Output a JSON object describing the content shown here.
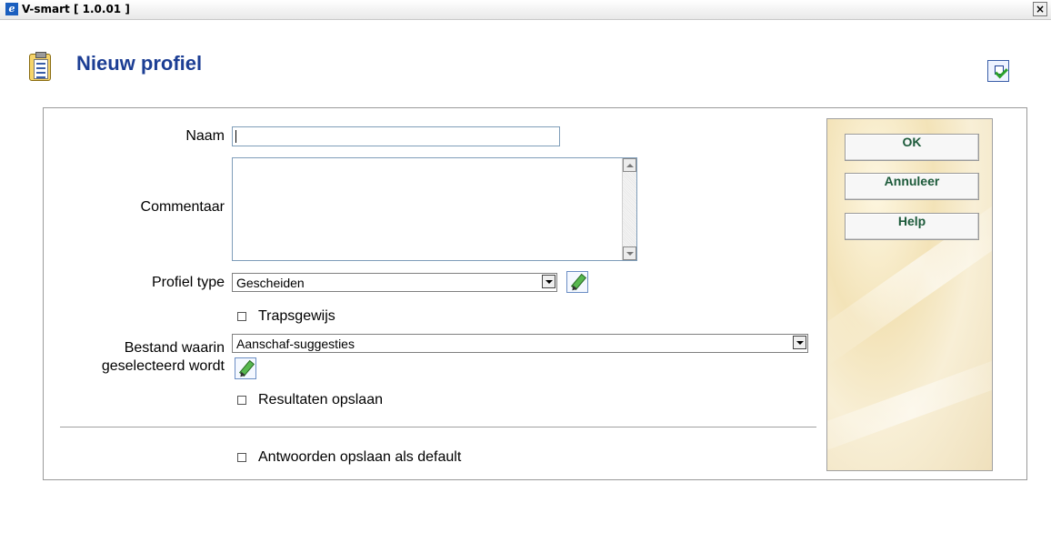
{
  "window": {
    "title": "V-smart [ 1.0.01 ]",
    "close_glyph": "×"
  },
  "header": {
    "title": "Nieuw profiel"
  },
  "form": {
    "naam_label": "Naam",
    "naam_value": "",
    "commentaar_label": "Commentaar",
    "commentaar_value": "",
    "profiel_type_label": "Profiel type",
    "profiel_type_value": "Gescheiden",
    "trapsgewijs_label": "Trapsgewijs",
    "trapsgewijs_checked": false,
    "bestand_label_line1": "Bestand waarin",
    "bestand_label_line2": "geselecteerd wordt",
    "bestand_value": "Aanschaf-suggesties",
    "resultaten_label": "Resultaten opslaan",
    "resultaten_checked": false,
    "antwoorden_label": "Antwoorden opslaan als default",
    "antwoorden_checked": false
  },
  "buttons": {
    "ok": "OK",
    "cancel": "Annuleer",
    "help": "Help"
  }
}
